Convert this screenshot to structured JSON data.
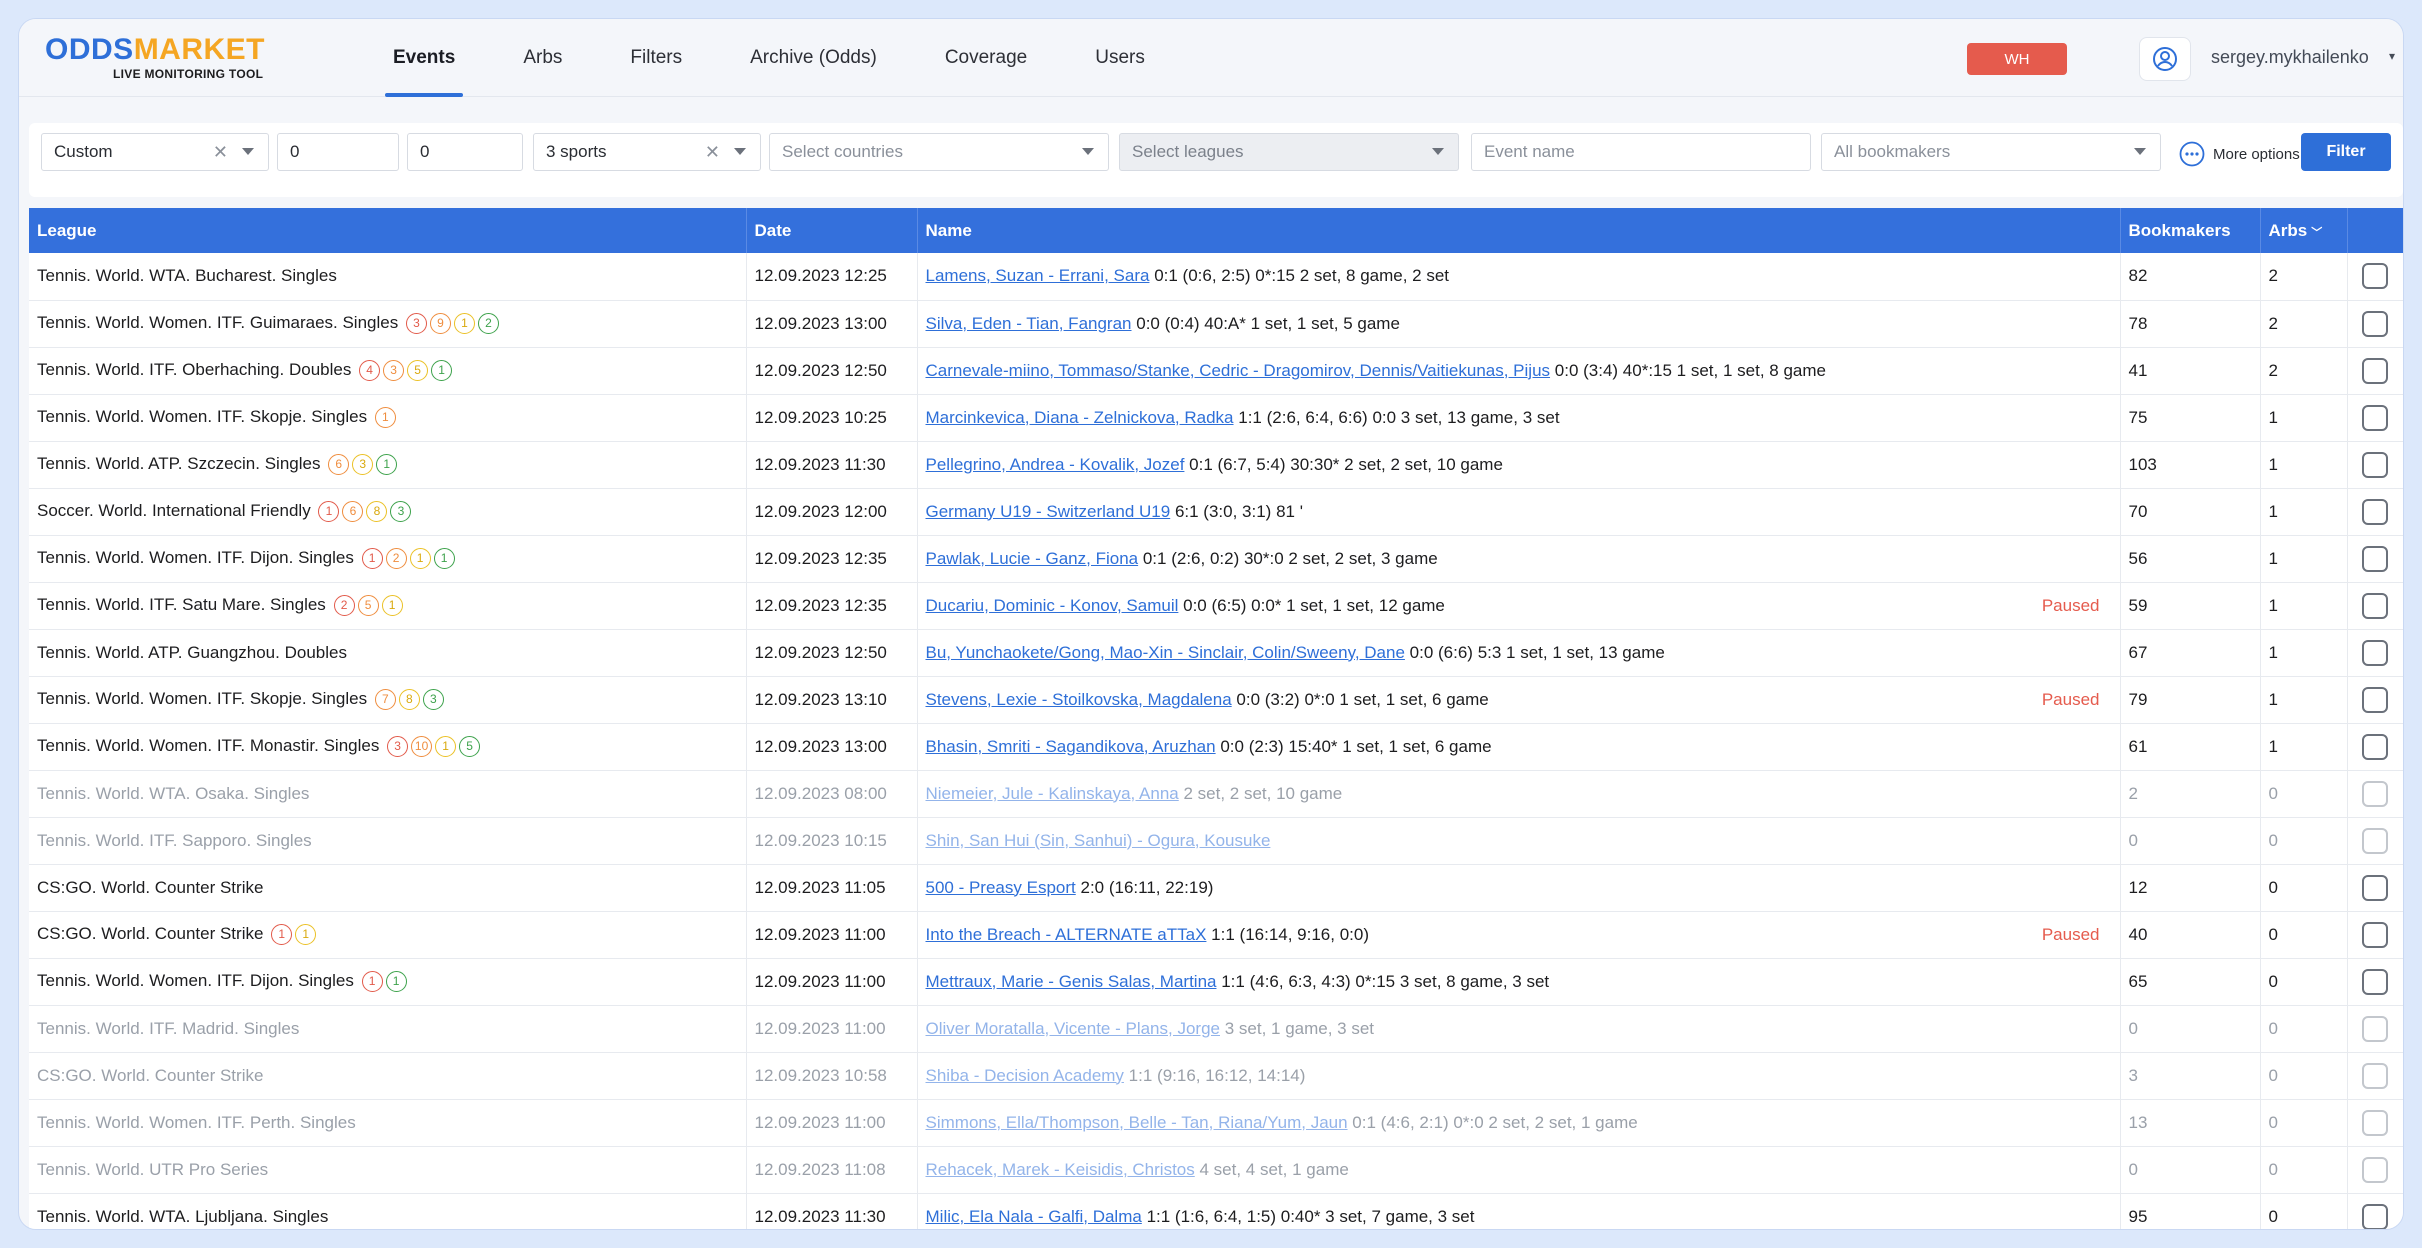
{
  "logo": {
    "part1": "ODDS",
    "part2": "MARKET",
    "subtitle": "LIVE MONITORING TOOL"
  },
  "nav": [
    {
      "label": "Events",
      "active": true
    },
    {
      "label": "Arbs"
    },
    {
      "label": "Filters"
    },
    {
      "label": "Archive (Odds)"
    },
    {
      "label": "Coverage"
    },
    {
      "label": "Users"
    }
  ],
  "header": {
    "wh_label": "WH",
    "username": "sergey.mykhailenko"
  },
  "filters": {
    "period": "Custom",
    "num1": "0",
    "num2": "0",
    "sports": "3 sports",
    "countries_placeholder": "Select countries",
    "leagues_placeholder": "Select leagues",
    "event_placeholder": "Event name",
    "bookmakers": "All bookmakers",
    "more_options": "More options",
    "filter_button": "Filter"
  },
  "table": {
    "headers": {
      "league": "League",
      "date": "Date",
      "name": "Name",
      "bookmakers": "Bookmakers",
      "arbs": "Arbs"
    },
    "rows": [
      {
        "league": "Tennis. World. WTA. Bucharest. Singles",
        "badges": [],
        "date": "12.09.2023 12:25",
        "link": "Lamens, Suzan - Errani, Sara",
        "info": "0:1 (0:6, 2:5) 0*:15 2 set, 8 game, 2 set",
        "status": "",
        "bookmakers": "82",
        "arbs": "2",
        "dim": false
      },
      {
        "league": "Tennis. World. Women. ITF. Guimaraes. Singles",
        "badges": [
          [
            "3",
            "red"
          ],
          [
            "9",
            "orange"
          ],
          [
            "1",
            "yellow"
          ],
          [
            "2",
            "green"
          ]
        ],
        "date": "12.09.2023 13:00",
        "link": "Silva, Eden - Tian, Fangran",
        "info": "0:0 (0:4) 40:A* 1 set, 1 set, 5 game",
        "status": "",
        "bookmakers": "78",
        "arbs": "2",
        "dim": false
      },
      {
        "league": "Tennis. World. ITF. Oberhaching. Doubles",
        "badges": [
          [
            "4",
            "red"
          ],
          [
            "3",
            "orange"
          ],
          [
            "5",
            "yellow"
          ],
          [
            "1",
            "green"
          ]
        ],
        "date": "12.09.2023 12:50",
        "link": "Carnevale-miino, Tommaso/Stanke, Cedric - Dragomirov, Dennis/Vaitiekunas, Pijus",
        "info": "0:0 (3:4) 40*:15 1 set, 1 set, 8 game",
        "status": "",
        "bookmakers": "41",
        "arbs": "2",
        "dim": false
      },
      {
        "league": "Tennis. World. Women. ITF. Skopje. Singles",
        "badges": [
          [
            "1",
            "orange"
          ]
        ],
        "date": "12.09.2023 10:25",
        "link": "Marcinkevica, Diana - Zelnickova, Radka",
        "info": "1:1 (2:6, 6:4, 6:6) 0:0 3 set, 13 game, 3 set",
        "status": "",
        "bookmakers": "75",
        "arbs": "1",
        "dim": false
      },
      {
        "league": "Tennis. World. ATP. Szczecin. Singles",
        "badges": [
          [
            "6",
            "orange"
          ],
          [
            "3",
            "yellow"
          ],
          [
            "1",
            "green"
          ]
        ],
        "date": "12.09.2023 11:30",
        "link": "Pellegrino, Andrea - Kovalik, Jozef",
        "info": "0:1 (6:7, 5:4) 30:30* 2 set, 2 set, 10 game",
        "status": "",
        "bookmakers": "103",
        "arbs": "1",
        "dim": false
      },
      {
        "league": "Soccer. World. International Friendly",
        "badges": [
          [
            "1",
            "red"
          ],
          [
            "6",
            "orange"
          ],
          [
            "8",
            "yellow"
          ],
          [
            "3",
            "green"
          ]
        ],
        "date": "12.09.2023 12:00",
        "link": "Germany U19 - Switzerland U19",
        "info": "6:1 (3:0, 3:1) 81 '",
        "status": "",
        "bookmakers": "70",
        "arbs": "1",
        "dim": false
      },
      {
        "league": "Tennis. World. Women. ITF. Dijon. Singles",
        "badges": [
          [
            "1",
            "red"
          ],
          [
            "2",
            "orange"
          ],
          [
            "1",
            "yellow"
          ],
          [
            "1",
            "green"
          ]
        ],
        "date": "12.09.2023 12:35",
        "link": "Pawlak, Lucie - Ganz, Fiona",
        "info": "0:1 (2:6, 0:2) 30*:0 2 set, 2 set, 3 game",
        "status": "",
        "bookmakers": "56",
        "arbs": "1",
        "dim": false
      },
      {
        "league": "Tennis. World. ITF. Satu Mare. Singles",
        "badges": [
          [
            "2",
            "red"
          ],
          [
            "5",
            "orange"
          ],
          [
            "1",
            "yellow"
          ]
        ],
        "date": "12.09.2023 12:35",
        "link": "Ducariu, Dominic - Konov, Samuil",
        "info": "0:0 (6:5) 0:0* 1 set, 1 set, 12 game",
        "status": "Paused",
        "bookmakers": "59",
        "arbs": "1",
        "dim": false
      },
      {
        "league": "Tennis. World. ATP. Guangzhou. Doubles",
        "badges": [],
        "date": "12.09.2023 12:50",
        "link": "Bu, Yunchaokete/Gong, Mao-Xin - Sinclair, Colin/Sweeny, Dane",
        "info": "0:0 (6:6) 5:3 1 set, 1 set, 13 game",
        "status": "",
        "bookmakers": "67",
        "arbs": "1",
        "dim": false
      },
      {
        "league": "Tennis. World. Women. ITF. Skopje. Singles",
        "badges": [
          [
            "7",
            "orange"
          ],
          [
            "8",
            "yellow"
          ],
          [
            "3",
            "green"
          ]
        ],
        "date": "12.09.2023 13:10",
        "link": "Stevens, Lexie - Stoilkovska, Magdalena",
        "info": "0:0 (3:2) 0*:0 1 set, 1 set, 6 game",
        "status": "Paused",
        "bookmakers": "79",
        "arbs": "1",
        "dim": false
      },
      {
        "league": "Tennis. World. Women. ITF. Monastir. Singles",
        "badges": [
          [
            "3",
            "red"
          ],
          [
            "10",
            "orange"
          ],
          [
            "1",
            "yellow"
          ],
          [
            "5",
            "green"
          ]
        ],
        "date": "12.09.2023 13:00",
        "link": "Bhasin, Smriti - Sagandikova, Aruzhan",
        "info": "0:0 (2:3) 15:40* 1 set, 1 set, 6 game",
        "status": "",
        "bookmakers": "61",
        "arbs": "1",
        "dim": false
      },
      {
        "league": "Tennis. World. WTA. Osaka. Singles",
        "badges": [],
        "date": "12.09.2023 08:00",
        "link": "Niemeier, Jule - Kalinskaya, Anna",
        "info": "2 set, 2 set, 10 game",
        "status": "",
        "bookmakers": "2",
        "arbs": "0",
        "dim": true
      },
      {
        "league": "Tennis. World. ITF. Sapporo. Singles",
        "badges": [],
        "date": "12.09.2023 10:15",
        "link": "Shin, San Hui (Sin, Sanhui) - Ogura, Kousuke",
        "info": "",
        "status": "",
        "bookmakers": "0",
        "arbs": "0",
        "dim": true
      },
      {
        "league": "CS:GO. World. Counter Strike",
        "badges": [],
        "date": "12.09.2023 11:05",
        "link": "500 - Preasy Esport",
        "info": "2:0 (16:11, 22:19)",
        "status": "",
        "bookmakers": "12",
        "arbs": "0",
        "dim": false
      },
      {
        "league": "CS:GO. World. Counter Strike",
        "badges": [
          [
            "1",
            "red"
          ],
          [
            "1",
            "yellow"
          ]
        ],
        "date": "12.09.2023 11:00",
        "link": "Into the Breach - ALTERNATE aTTaX",
        "info": "1:1 (16:14, 9:16, 0:0)",
        "status": "Paused",
        "bookmakers": "40",
        "arbs": "0",
        "dim": false
      },
      {
        "league": "Tennis. World. Women. ITF. Dijon. Singles",
        "badges": [
          [
            "1",
            "red"
          ],
          [
            "1",
            "green"
          ]
        ],
        "date": "12.09.2023 11:00",
        "link": "Mettraux, Marie - Genis Salas, Martina",
        "info": "1:1 (4:6, 6:3, 4:3) 0*:15 3 set, 8 game, 3 set",
        "status": "",
        "bookmakers": "65",
        "arbs": "0",
        "dim": false
      },
      {
        "league": "Tennis. World. ITF. Madrid. Singles",
        "badges": [],
        "date": "12.09.2023 11:00",
        "link": "Oliver Moratalla, Vicente - Plans, Jorge",
        "info": "3 set, 1 game, 3 set",
        "status": "",
        "bookmakers": "0",
        "arbs": "0",
        "dim": true
      },
      {
        "league": "CS:GO. World. Counter Strike",
        "badges": [],
        "date": "12.09.2023 10:58",
        "link": "Shiba - Decision Academy",
        "info": "1:1 (9:16, 16:12, 14:14)",
        "status": "",
        "bookmakers": "3",
        "arbs": "0",
        "dim": true
      },
      {
        "league": "Tennis. World. Women. ITF. Perth. Singles",
        "badges": [],
        "date": "12.09.2023 11:00",
        "link": "Simmons, Ella/Thompson, Belle - Tan, Riana/Yum, Jaun",
        "info": "0:1 (4:6, 2:1) 0*:0 2 set, 2 set, 1 game",
        "status": "",
        "bookmakers": "13",
        "arbs": "0",
        "dim": true
      },
      {
        "league": "Tennis. World. UTR Pro Series",
        "badges": [],
        "date": "12.09.2023 11:08",
        "link": "Rehacek, Marek - Keisidis, Christos",
        "info": "4 set, 4 set, 1 game",
        "status": "",
        "bookmakers": "0",
        "arbs": "0",
        "dim": true
      },
      {
        "league": "Tennis. World. WTA. Ljubljana. Singles",
        "badges": [],
        "date": "12.09.2023 11:30",
        "link": "Milic, Ela Nala - Galfi, Dalma",
        "info": "1:1 (1:6, 6:4, 1:5) 0:40* 3 set, 7 game, 3 set",
        "status": "",
        "bookmakers": "95",
        "arbs": "0",
        "dim": false
      }
    ]
  }
}
